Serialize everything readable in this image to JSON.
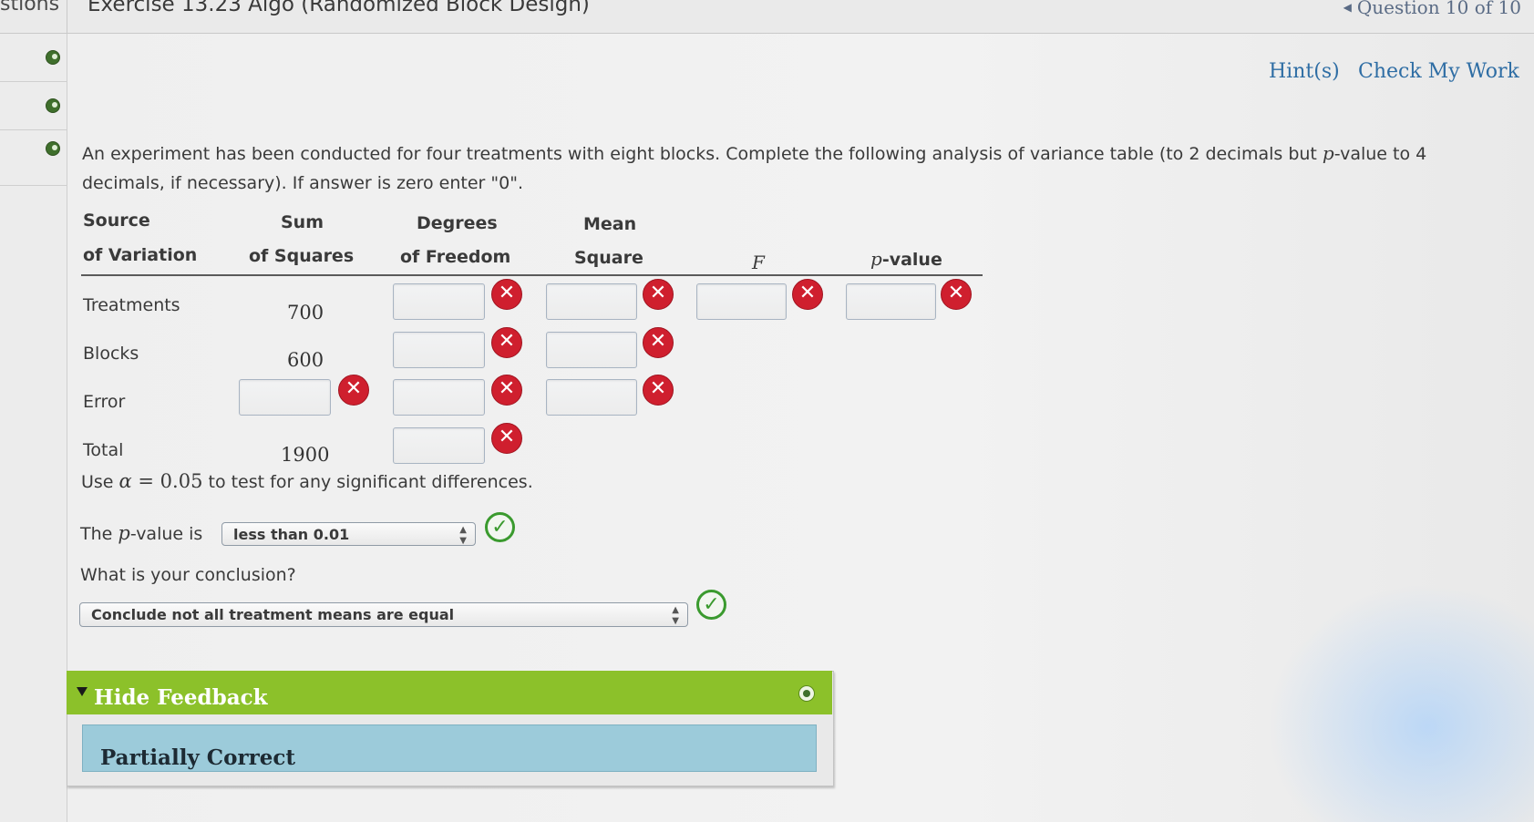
{
  "header": {
    "left_fragment": "stions",
    "exercise_title": "Exercise 13.23 Algo (Randomized Block Design)",
    "question_nav": "Question 10 of 10"
  },
  "links": {
    "hints": "Hint(s)",
    "check_work": "Check My Work"
  },
  "prompt": {
    "part1": "An experiment has been conducted for four treatments with eight blocks. Complete the following analysis of variance table (to 2 decimals but ",
    "p_symbol": "p",
    "part2": "-value to 4 decimals, if necessary). If answer is zero enter \"0\"."
  },
  "table": {
    "headers": {
      "source_1": "Source",
      "source_2": "of Variation",
      "sum_1": "Sum",
      "sum_2": "of Squares",
      "df_1": "Degrees",
      "df_2": "of Freedom",
      "ms_1": "Mean",
      "ms_2": "Square",
      "f": "F",
      "p_symbol": "p",
      "p_suffix": "-value"
    },
    "rows": {
      "treatments": {
        "label": "Treatments",
        "ss": "700"
      },
      "blocks": {
        "label": "Blocks",
        "ss": "600"
      },
      "error": {
        "label": "Error",
        "ss": ""
      },
      "total": {
        "label": "Total",
        "ss": "1900"
      }
    }
  },
  "alpha_line": {
    "prefix": "Use ",
    "alpha": "α",
    "equals": " = 0.05",
    "suffix": " to test for any significant differences."
  },
  "pvalue_question": {
    "prefix": "The ",
    "p_symbol": "p",
    "suffix": "-value is",
    "selected": "less than 0.01"
  },
  "conclusion": {
    "question": "What is your conclusion?",
    "selected": "Conclude not all treatment means are equal"
  },
  "feedback": {
    "title": "Hide Feedback",
    "status": "Partially Correct"
  },
  "colors": {
    "feedback_header": "#8cc12a",
    "feedback_body": "#9ccbda",
    "incorrect": "#cf1f2e",
    "correct": "#3a9a2e",
    "link": "#2e6da4"
  }
}
